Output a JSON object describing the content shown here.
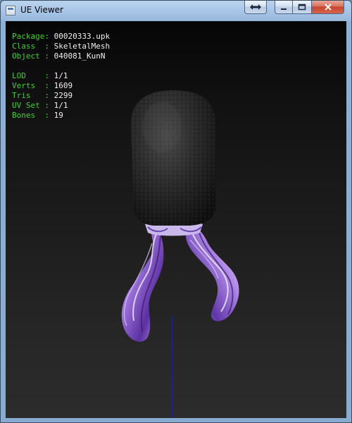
{
  "window": {
    "title": "UE Viewer",
    "buttons": {
      "swap": "⇔",
      "minimize": "—",
      "maximize": "□",
      "close": "✕"
    }
  },
  "info": {
    "package": {
      "label": "Package:",
      "value": "00020333.upk"
    },
    "class": {
      "label": "Class  :",
      "value": "SkeletalMesh"
    },
    "object": {
      "label": "Object :",
      "value": "040081_KunN"
    },
    "lod": {
      "label": "LOD    :",
      "value": "1/1"
    },
    "verts": {
      "label": "Verts  :",
      "value": "1609"
    },
    "tris": {
      "label": "Tris   :",
      "value": "2299"
    },
    "uvset": {
      "label": "UV Set :",
      "value": "1/1"
    },
    "bones": {
      "label": "Bones  :",
      "value": "19"
    }
  },
  "colors": {
    "info_key": "#3fd12f",
    "info_value": "#f0f0f0",
    "axis": "#1a1ad0",
    "mesh_dark": "#2b2b2b",
    "hair_purple": "#8a5fd0"
  }
}
